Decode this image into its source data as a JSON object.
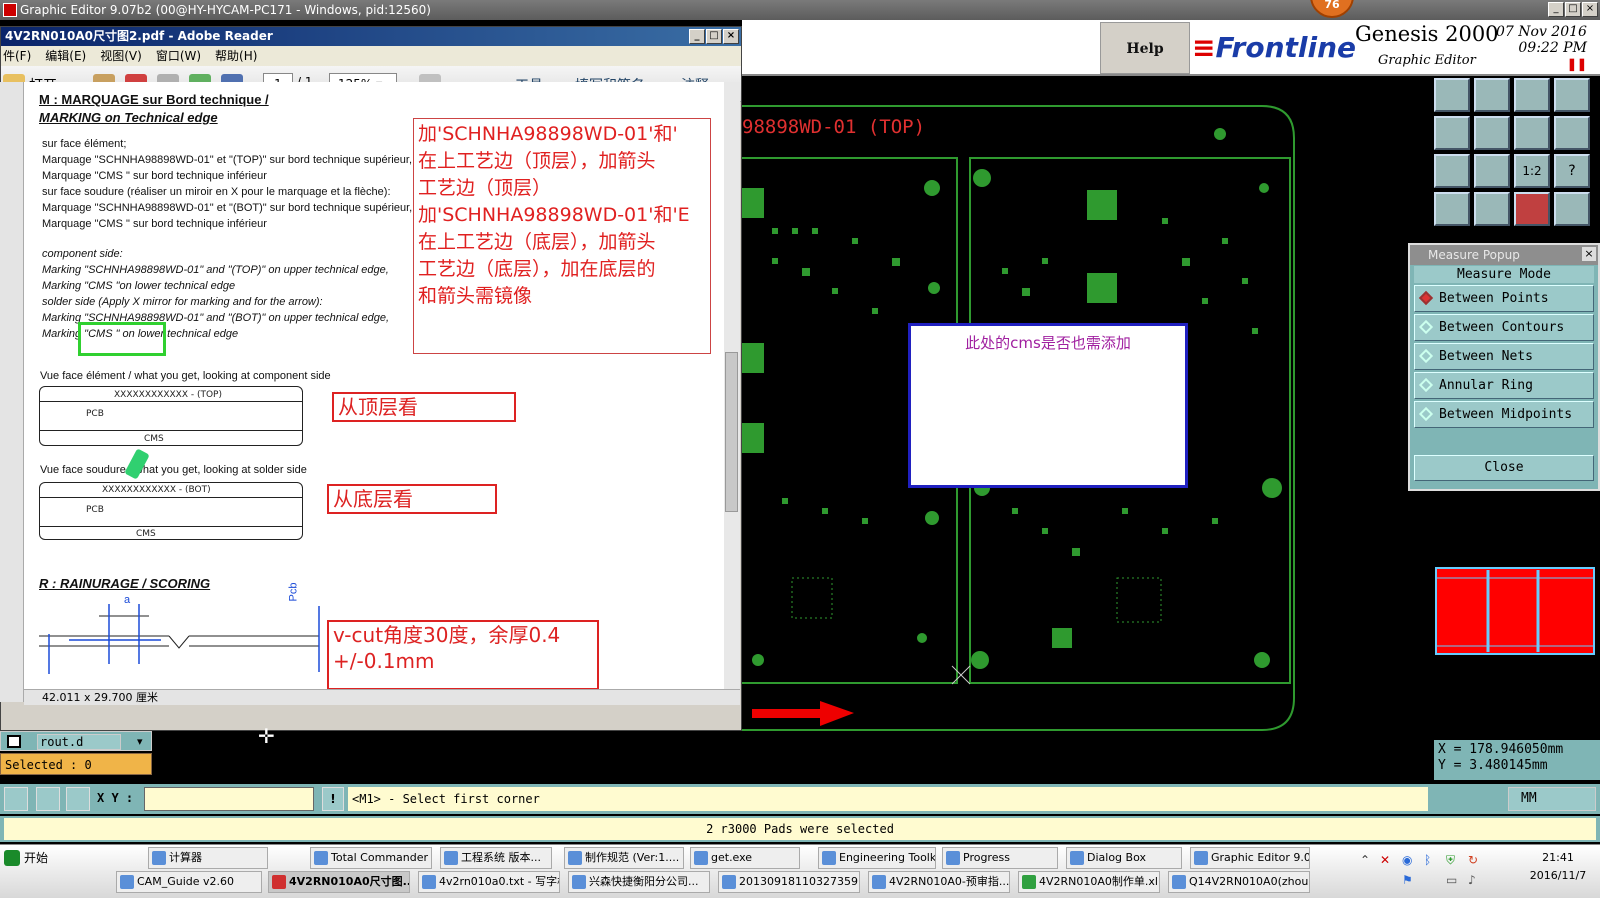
{
  "outer_window": {
    "title": "Graphic Editor 9.07b2 (00@HY-HYCAM-PC171 - Windows, pid:12560)"
  },
  "genesis": {
    "help_label": "Help",
    "logo_text": "Frontline",
    "product": "Genesis 2000",
    "subtitle": "Graphic Editor",
    "date": "07 Nov 2016",
    "time": "09:22 PM",
    "badge": "76"
  },
  "pdf": {
    "title": "4V2RN010A0尺寸图2.pdf - Adobe Reader",
    "menu": [
      "件(F)",
      "编辑(E)",
      "视图(V)",
      "窗口(W)",
      "帮助(H)"
    ],
    "toolbar": {
      "open": "打开",
      "page": "1",
      "page_total": "/ 1",
      "zoom": "125%",
      "tools": "工具",
      "sign": "填写和签名",
      "comment": "注释"
    },
    "status": "42.011 x 29.700 厘米",
    "doc": {
      "heading1": "M : MARQUAGE sur Bord technique  /",
      "heading1b": "MARKING on Technical edge",
      "fr_lines": [
        "sur face élément;",
        "Marquage \"SCHNHA98898WD-01\" et \"(TOP)\" sur bord technique supérieur,",
        "Marquage \"CMS          \" sur bord technique inférieur",
        "sur face soudure (réaliser un miroir en X pour le marquage et la flèche):",
        "Marquage \"SCHNHA98898WD-01\" et \"(BOT)\" sur bord technique supérieur,",
        "Marquage \"CMS          \" sur bord technique inférieur"
      ],
      "en_lines": [
        "component side:",
        "Marking \"SCHNHA98898WD-01\" and \"(TOP)\" on upper technical edge,",
        "Marking \"CMS          \"on lower technical edge",
        "solder side (Apply X mirror for marking and for the arrow):",
        "Marking \"SCHNHA98898WD-01\" and \"(BOT)\" on upper technical edge,",
        "Marking \"CMS          \" on lower technical edge"
      ],
      "callout_lines": [
        "加'SCHNHA98898WD-01'和'",
        "在上工艺边（顶层），加箭头",
        "工艺边（顶层）",
        "加'SCHNHA98898WD-01'和'E",
        "在上工艺边（底层），加箭头",
        "工艺边（底层），加在底层的",
        "和箭头需镜像"
      ],
      "view_top_caption": "Vue face élément / what you get, looking at component side",
      "view_top_strip": "XXXXXXXXXXXX - (TOP)",
      "view_bot_caption": "Vue face soudure / what you get, looking at solder side",
      "view_bot_strip": "XXXXXXXXXXXX - (BOT)",
      "pcb": "PCB",
      "cms": "CMS",
      "from_top": "从顶层看",
      "from_bottom": "从底层看",
      "heading2": "R : RAINURAGE / SCORING",
      "scoring_a": "a",
      "scoring_pcb": "Pcb",
      "vcut_note_1": "v-cut角度30度，余厚0.4",
      "vcut_note_2": "+/-0.1mm"
    }
  },
  "cad": {
    "label": "98898WD-01   (TOP)",
    "note": "此处的cms是否也需添加"
  },
  "measure_popup": {
    "title": "Measure Popup",
    "mode_label": "Measure Mode",
    "options": [
      "Between Points",
      "Between Contours",
      "Between Nets",
      "Annular Ring",
      "Between Midpoints"
    ],
    "selected": "Between Points",
    "close_label": "Close"
  },
  "coords": {
    "x": "X  =  178.946050mm",
    "y": "Y  =  3.480145mm"
  },
  "layer": {
    "name": "rout.d"
  },
  "selected_text": "Selected : 0",
  "cmd": {
    "xy_label": "X Y :",
    "prompt": "<M1> - Select first corner",
    "unit": "MM"
  },
  "message": "2 r3000 Pads were selected",
  "taskbar": {
    "start": "开始",
    "row1": [
      "计算器",
      "Total Commander ...",
      "工程系统  版本...",
      "制作规范 (Ver:1....",
      "get.exe",
      "Engineering Toolki...",
      "Progress",
      "Dialog Box",
      "Graphic Editor 9.0..."
    ],
    "row2": [
      "CAM_Guide v2.60",
      "4V2RN010A0尺寸图...",
      "4v2rn010a0.txt - 写字板",
      "兴森快捷衡阳分公司...",
      "20130918110327359.r...",
      "4V2RN010A0-预审指...",
      "4V2RN010A0制作单.xl...",
      "Q14V2RN010A0(zhoub..."
    ],
    "active": "4V2RN010A0尺寸图...",
    "clock_time": "21:41",
    "clock_date": "2016/11/7"
  },
  "colors": {
    "cad_green": "#2f9a2f",
    "cad_bright": "#3fd23f",
    "panel": "#7fb5b5",
    "alert_red": "#e02020"
  }
}
